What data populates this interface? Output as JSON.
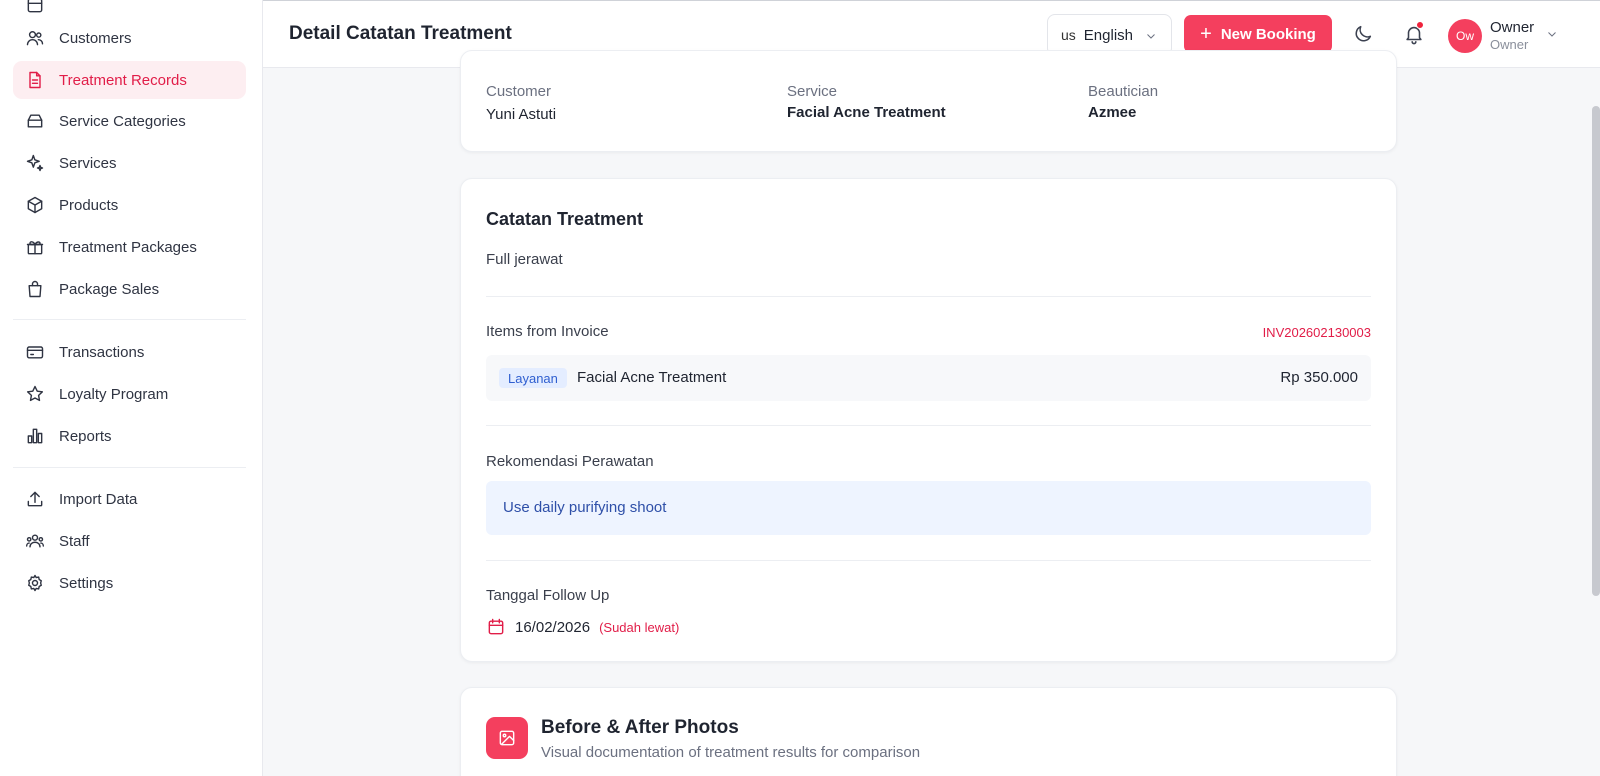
{
  "sidebar": {
    "items": [
      {
        "label": "Customers",
        "icon": "users-icon"
      },
      {
        "label": "Treatment Records",
        "icon": "document-icon",
        "active": true
      },
      {
        "label": "Service Categories",
        "icon": "stack-icon"
      },
      {
        "label": "Services",
        "icon": "sparkles-icon"
      },
      {
        "label": "Products",
        "icon": "cube-icon"
      },
      {
        "label": "Treatment Packages",
        "icon": "gift-icon"
      },
      {
        "label": "Package Sales",
        "icon": "shopping-bag-icon"
      },
      {
        "label": "Transactions",
        "icon": "credit-card-icon"
      },
      {
        "label": "Loyalty Program",
        "icon": "star-icon"
      },
      {
        "label": "Reports",
        "icon": "bar-chart-icon"
      },
      {
        "label": "Import Data",
        "icon": "upload-icon"
      },
      {
        "label": "Staff",
        "icon": "team-icon"
      },
      {
        "label": "Settings",
        "icon": "gear-icon"
      }
    ]
  },
  "header": {
    "title": "Detail Catatan Treatment",
    "language": {
      "flag": "us",
      "label": "English"
    },
    "new_booking_label": "New Booking",
    "user": {
      "initials": "Ow",
      "name": "Owner",
      "role": "Owner"
    }
  },
  "summary": {
    "customer_label": "Customer",
    "customer_value": "Yuni Astuti",
    "service_label": "Service",
    "service_value": "Facial Acne Treatment",
    "beautician_label": "Beautician",
    "beautician_value": "Azmee"
  },
  "notes": {
    "title": "Catatan Treatment",
    "text": "Full jerawat",
    "items_label": "Items from Invoice",
    "invoice_number": "INV202602130003",
    "item": {
      "badge": "Layanan",
      "name": "Facial Acne Treatment",
      "price": "Rp 350.000"
    },
    "recommendation_label": "Rekomendasi Perawatan",
    "recommendation_text": "Use daily purifying shoot",
    "followup_label": "Tanggal Follow Up",
    "followup_date": "16/02/2026",
    "followup_status": "(Sudah lewat)"
  },
  "photos": {
    "title": "Before & After Photos",
    "subtitle": "Visual documentation of treatment results for comparison"
  },
  "colors": {
    "accent": "#f43f5e",
    "accent_text": "#e11d48",
    "active_bg": "#fdeef1",
    "info_bg": "#eef4ff"
  }
}
